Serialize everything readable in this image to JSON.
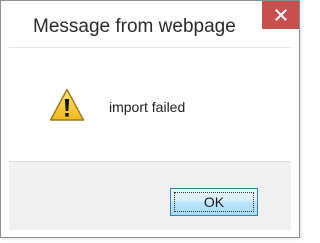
{
  "dialog": {
    "title": "Message from webpage",
    "message": "import failed",
    "icon": "warning-icon",
    "ok_label": "OK"
  },
  "colors": {
    "close_button": "#c7504f",
    "footer_background": "#f0f0f0",
    "warning_yellow": "#f2c62c",
    "button_border": "#3c7fb1"
  }
}
